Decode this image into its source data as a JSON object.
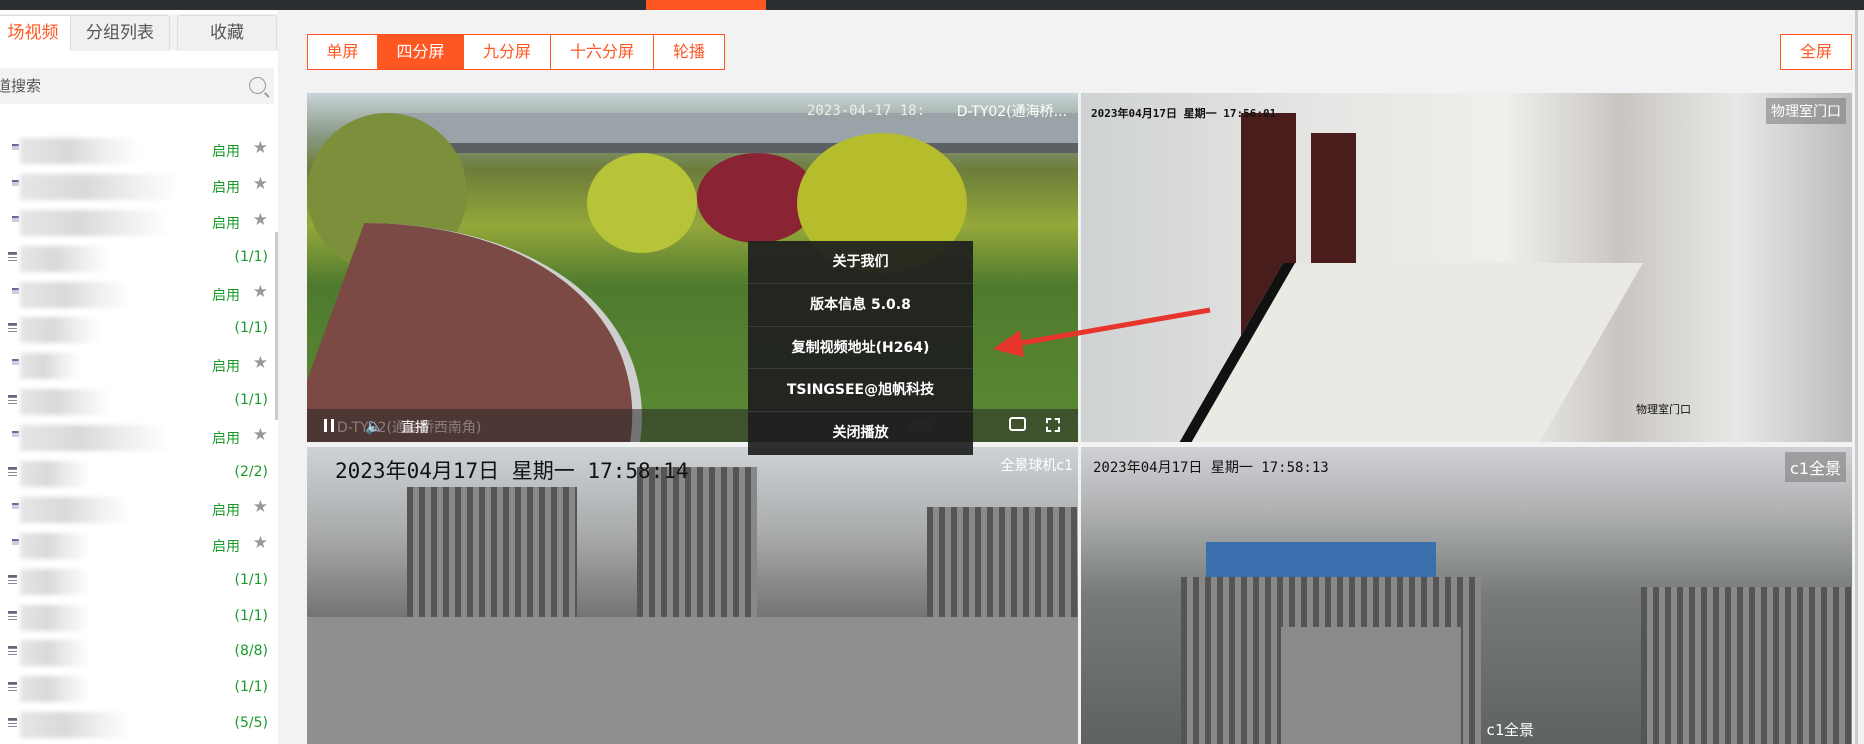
{
  "sidebar": {
    "tabs": [
      {
        "label": "场视频",
        "active": true
      },
      {
        "label": "分组列表"
      },
      {
        "label": "收藏"
      }
    ],
    "search_placeholder": "道搜索",
    "items": [
      {
        "type": "camera",
        "status": "启用"
      },
      {
        "type": "camera",
        "status": "启用"
      },
      {
        "type": "camera",
        "status": "启用"
      },
      {
        "type": "group",
        "status": "(1/1)"
      },
      {
        "type": "camera",
        "status": "启用"
      },
      {
        "type": "group",
        "status": "(1/1)"
      },
      {
        "type": "camera",
        "status": "启用"
      },
      {
        "type": "group",
        "status": "(1/1)"
      },
      {
        "type": "camera",
        "status": "启用"
      },
      {
        "type": "group",
        "status": "(2/2)"
      },
      {
        "type": "camera",
        "status": "启用"
      },
      {
        "type": "camera",
        "status": "启用"
      },
      {
        "type": "group",
        "status": "(1/1)"
      },
      {
        "type": "group",
        "status": "(1/1)"
      },
      {
        "type": "group",
        "status": "(8/8)"
      },
      {
        "type": "group",
        "status": "(1/1)"
      },
      {
        "type": "group",
        "status": "(5/5)"
      }
    ]
  },
  "toolbar": {
    "layouts": [
      {
        "label": "单屏"
      },
      {
        "label": "四分屏",
        "active": true
      },
      {
        "label": "九分屏"
      },
      {
        "label": "十六分屏"
      },
      {
        "label": "轮播"
      }
    ],
    "fullscreen": "全屏"
  },
  "accent_color": "#ff5722",
  "status_color": "#1a9a2a",
  "videos": [
    {
      "title": "D-TY02(通海桥...",
      "osd": "2023-04-17 18:",
      "bar_label": "直播",
      "bar_name": "D-TY02(通海桥西南角)",
      "bar_extra": "拉伸"
    },
    {
      "title": "物理室门口",
      "osd": "2023年04月17日 星期一 17:56:01",
      "osd2": "物理室门口"
    },
    {
      "title": "全景球机c1",
      "osd": "2023年04月17日 星期一 17:58:14"
    },
    {
      "title": "c1全景",
      "osd": "2023年04月17日 星期一 17:58:13",
      "osd2": "c1全景"
    }
  ],
  "context_menu": [
    "关于我们",
    "版本信息 5.0.8",
    "复制视频地址(H264)",
    "TSINGSEE@旭帆科技",
    "关闭播放"
  ]
}
